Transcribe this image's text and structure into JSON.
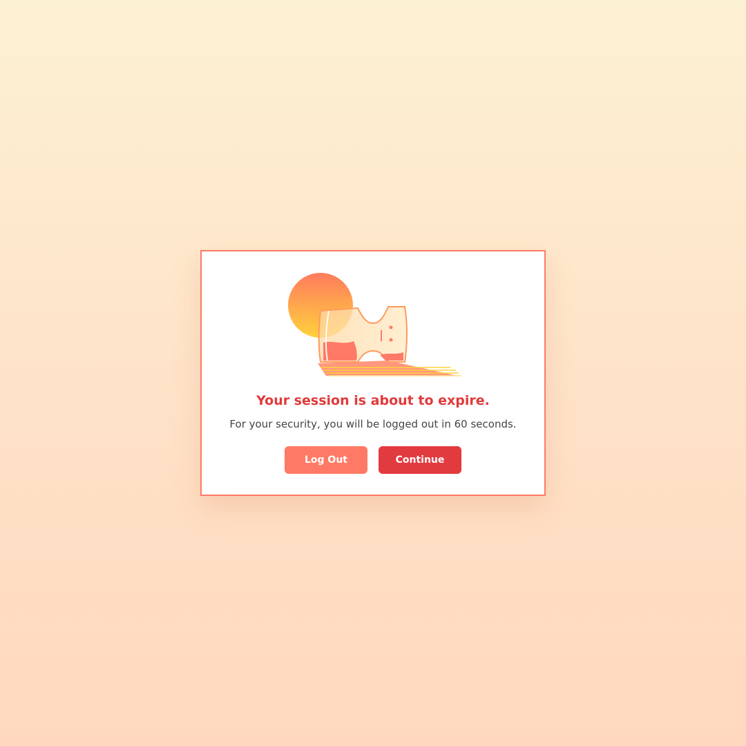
{
  "dialog": {
    "illustration_icon": "hourglass-sunset-icon",
    "title": "Your session is about to expire.",
    "message": "For your security, you will be logged out in 60 seconds.",
    "logout_label": "Log Out",
    "continue_label": "Continue"
  },
  "colors": {
    "background_top": "#fdf1d3",
    "background_bottom": "#ffd8bf",
    "dialog_border": "#ff7a66",
    "title": "#e13a3a",
    "logout_button": "#ff7a66",
    "continue_button": "#e23b3f"
  }
}
